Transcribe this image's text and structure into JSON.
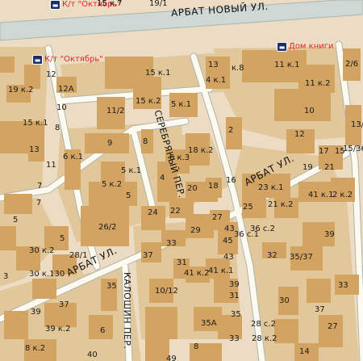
{
  "colors": {
    "block": "#e2c79b",
    "building": "#d3a362",
    "road": "#fffaf0",
    "road_edge": "#a9b6b0",
    "major_road": "#cfd8d5",
    "poi_text": "#e8231f",
    "bus_icon": "#1b2f6e"
  },
  "streets": {
    "novy_arbat": "АРБАТ НОВЫЙ УЛ.",
    "arbat_mid": "АРБАТ УЛ.",
    "arbat_low": "АРБАТ УЛ.",
    "serebryany": "СЕРЕБРЯНЫЙ ПЕР.",
    "kaloshin": "КАЛОШИН ПЕР."
  },
  "pois": [
    {
      "label": "К/т \"Октябрь\"",
      "icon": "bus-stop-icon"
    },
    {
      "label": "К/т \"Октябрь\"",
      "icon": "bus-stop-icon"
    },
    {
      "label": "Дом книги",
      "icon": "bus-stop-icon"
    }
  ],
  "house_numbers": [
    "19/1",
    "15 к.7",
    "13",
    "к.8",
    "11 к.1",
    "2/6",
    "12",
    "15 к.1",
    "4 к.1",
    "19 к.2",
    "12А",
    "11 к.2",
    "15 к.2",
    "5 к.1",
    "11/2",
    "10",
    "15 к.1",
    "8",
    "13/1",
    "10",
    "2",
    "12",
    "17",
    "15",
    "15/36",
    "13",
    "9",
    "18 к.2",
    "8",
    "6 к.3",
    "19",
    "21",
    "11",
    "6 к.1",
    "5 к.1",
    "5 к.2",
    "16",
    "23 к.1",
    "7",
    "4",
    "41 к.1",
    "2 к.2",
    "5",
    "20",
    "18",
    "7",
    "5",
    "24",
    "22",
    "27",
    "25",
    "21 к.2",
    "43",
    "26/2",
    "45",
    "5",
    "29",
    "36 с.1",
    "36 с.2",
    "39",
    "30 к.2",
    "28/1",
    "33",
    "32",
    "35/37",
    "37",
    "30 к.130",
    "31",
    "41 к.2",
    "43",
    "41 к.1",
    "3",
    "35",
    "10/12",
    "39",
    "33",
    "31",
    "37",
    "30",
    "39",
    "35",
    "35А",
    "37",
    "27",
    "39 к.2",
    "8 к.2",
    "6",
    "8",
    "33",
    "28 с.2",
    "28 к.2",
    "14",
    "40",
    "49"
  ]
}
